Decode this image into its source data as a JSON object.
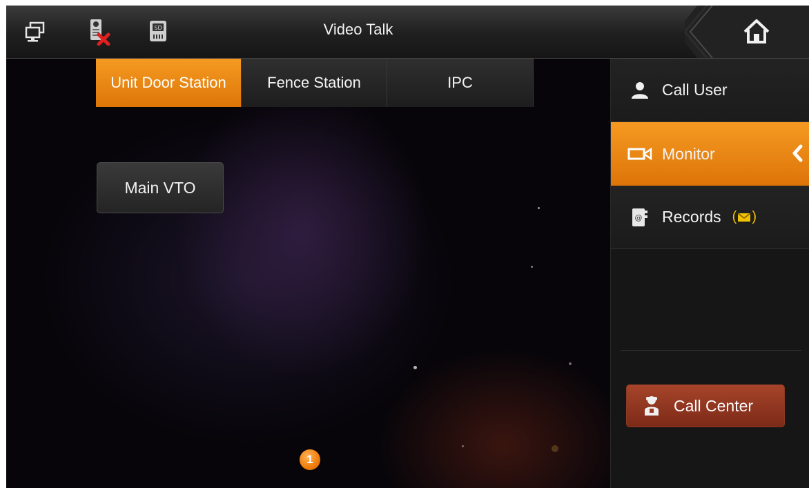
{
  "header": {
    "title": "Video Talk",
    "icons": [
      "monitor-icon",
      "disconnected-device-icon",
      "sd-card-icon",
      "home-icon"
    ]
  },
  "tabs": [
    {
      "label": "Unit Door Station",
      "active": true
    },
    {
      "label": "Fence Station",
      "active": false
    },
    {
      "label": "IPC",
      "active": false
    }
  ],
  "devices": [
    {
      "label": "Main VTO"
    }
  ],
  "pagination": {
    "current_page": "1"
  },
  "sidebar": {
    "items": [
      {
        "label": "Call User",
        "icon": "user-icon",
        "active": false
      },
      {
        "label": "Monitor",
        "icon": "camera-icon",
        "active": true
      },
      {
        "label": "Records",
        "icon": "records-icon",
        "active": false
      }
    ],
    "call_center": {
      "label": "Call Center",
      "icon": "operator-icon"
    }
  },
  "colors": {
    "accent": "#f08a12",
    "call_center": "#8f3520",
    "bar": "#1f1f1f"
  }
}
